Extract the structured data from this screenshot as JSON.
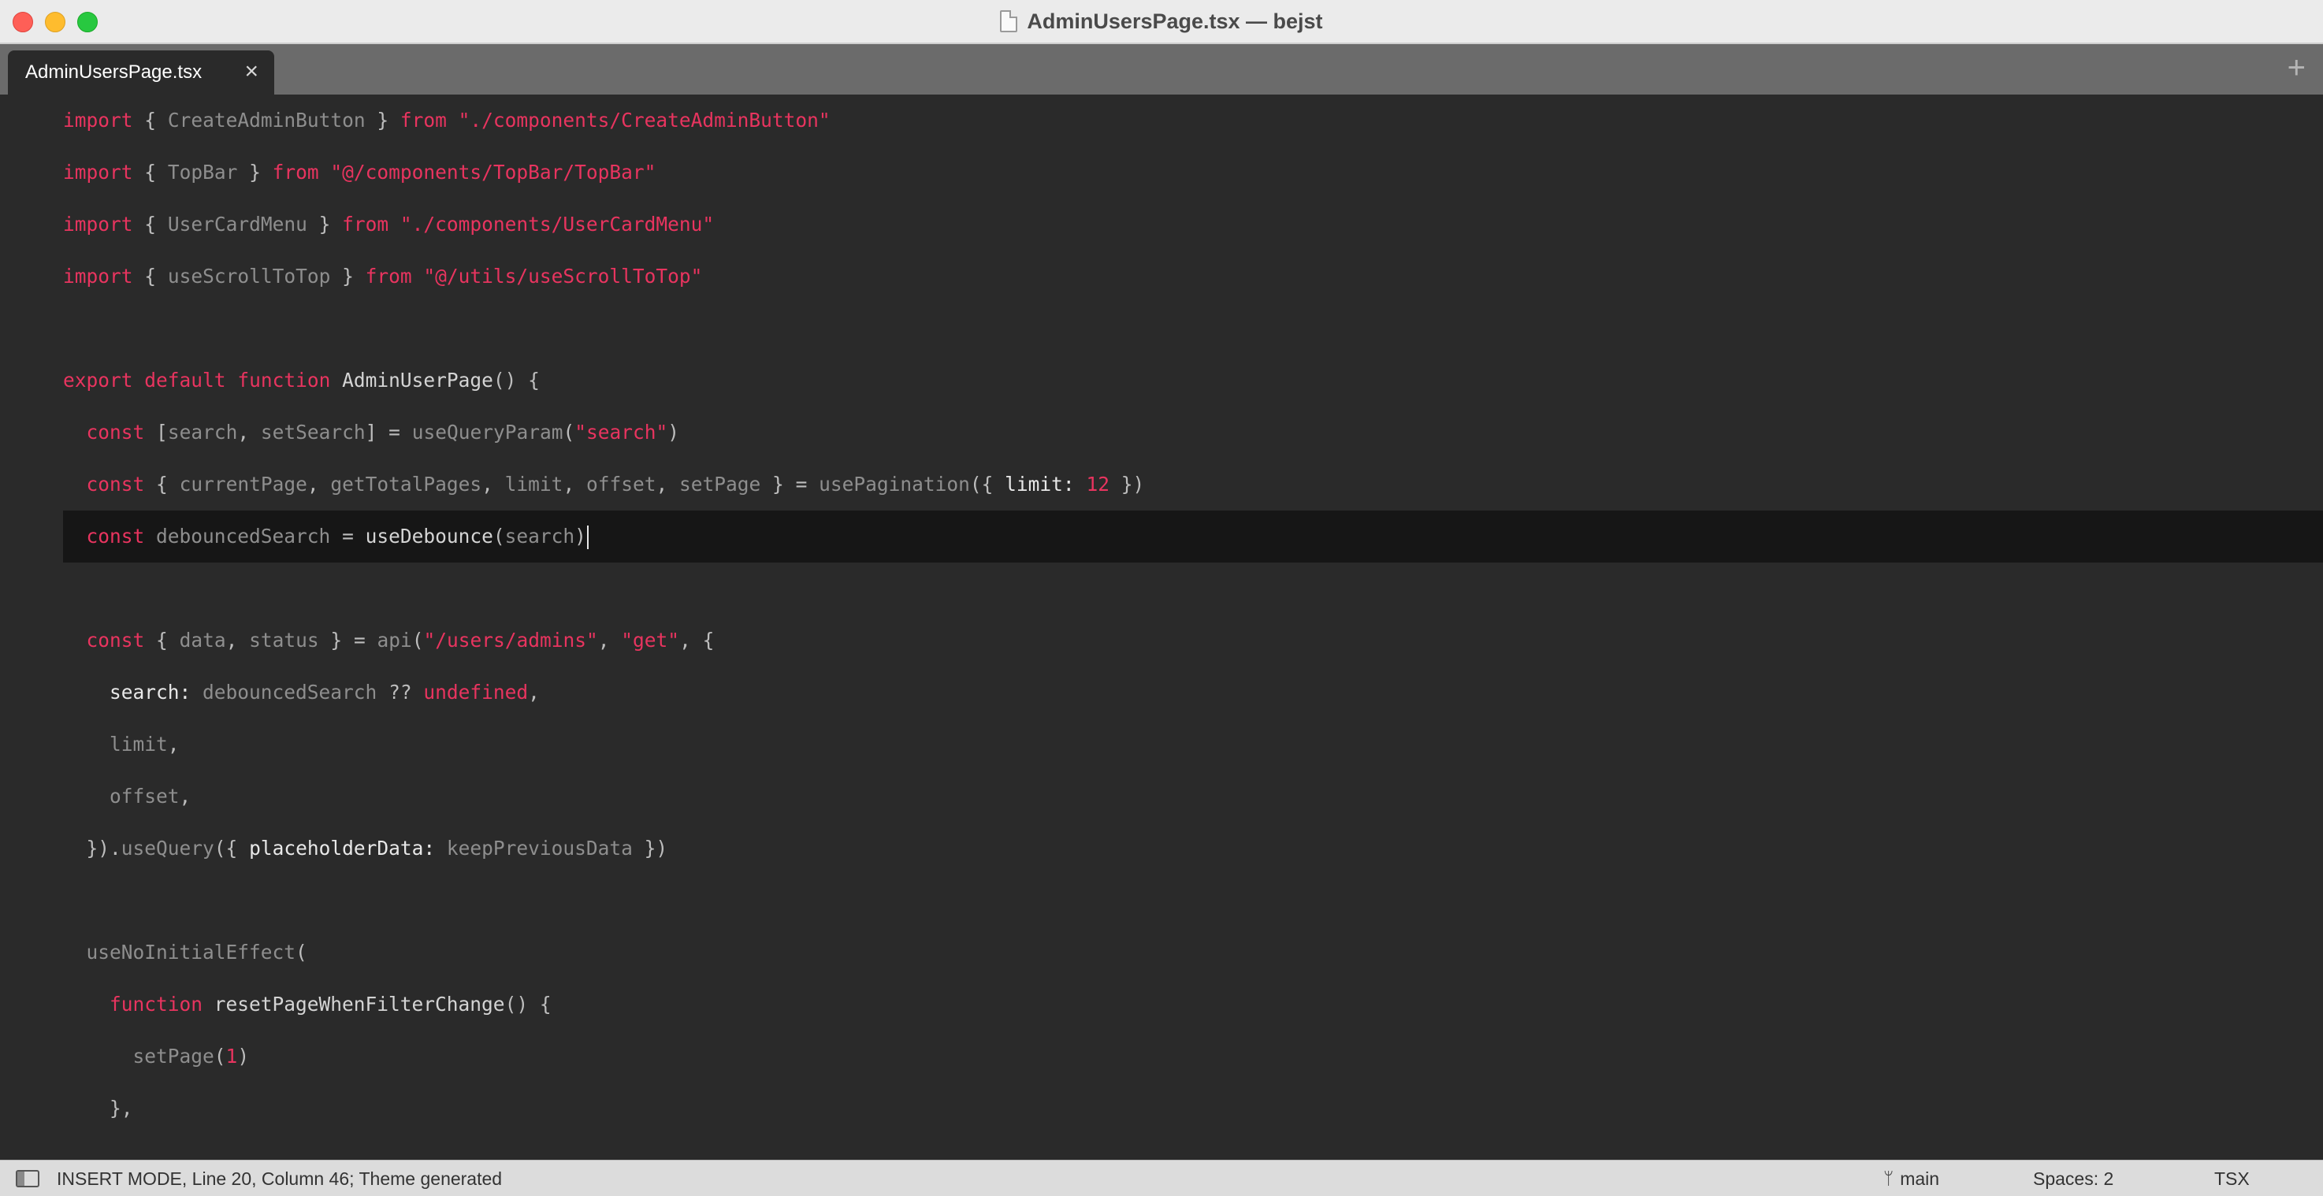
{
  "window": {
    "title": "AdminUsersPage.tsx — bejst"
  },
  "tabs": [
    {
      "label": "AdminUsersPage.tsx",
      "close": "×",
      "active": true
    }
  ],
  "tab_add": "+",
  "editor": {
    "current_line": 20,
    "current_column": 46,
    "lines": [
      "import { CreateAdminButton } from \"./components/CreateAdminButton\"",
      "import { TopBar } from \"@/components/TopBar/TopBar\"",
      "import { UserCardMenu } from \"./components/UserCardMenu\"",
      "import { useScrollToTop } from \"@/utils/useScrollToTop\"",
      "",
      "export default function AdminUserPage() {",
      "  const [search, setSearch] = useQueryParam(\"search\")",
      "  const { currentPage, getTotalPages, limit, offset, setPage } = usePagination({ limit: 12 })",
      "  const debouncedSearch = useDebounce(search)",
      "",
      "  const { data, status } = api(\"/users/admins\", \"get\", {",
      "    search: debouncedSearch ?? undefined,",
      "    limit,",
      "    offset,",
      "  }).useQuery({ placeholderData: keepPreviousData })",
      "",
      "  useNoInitialEffect(",
      "    function resetPageWhenFilterChange() {",
      "      setPage(1)",
      "    },"
    ]
  },
  "statusbar": {
    "mode_text": "INSERT MODE, Line 20, Column 46; Theme generated",
    "branch": "main",
    "spaces": "Spaces: 2",
    "language": "TSX"
  }
}
